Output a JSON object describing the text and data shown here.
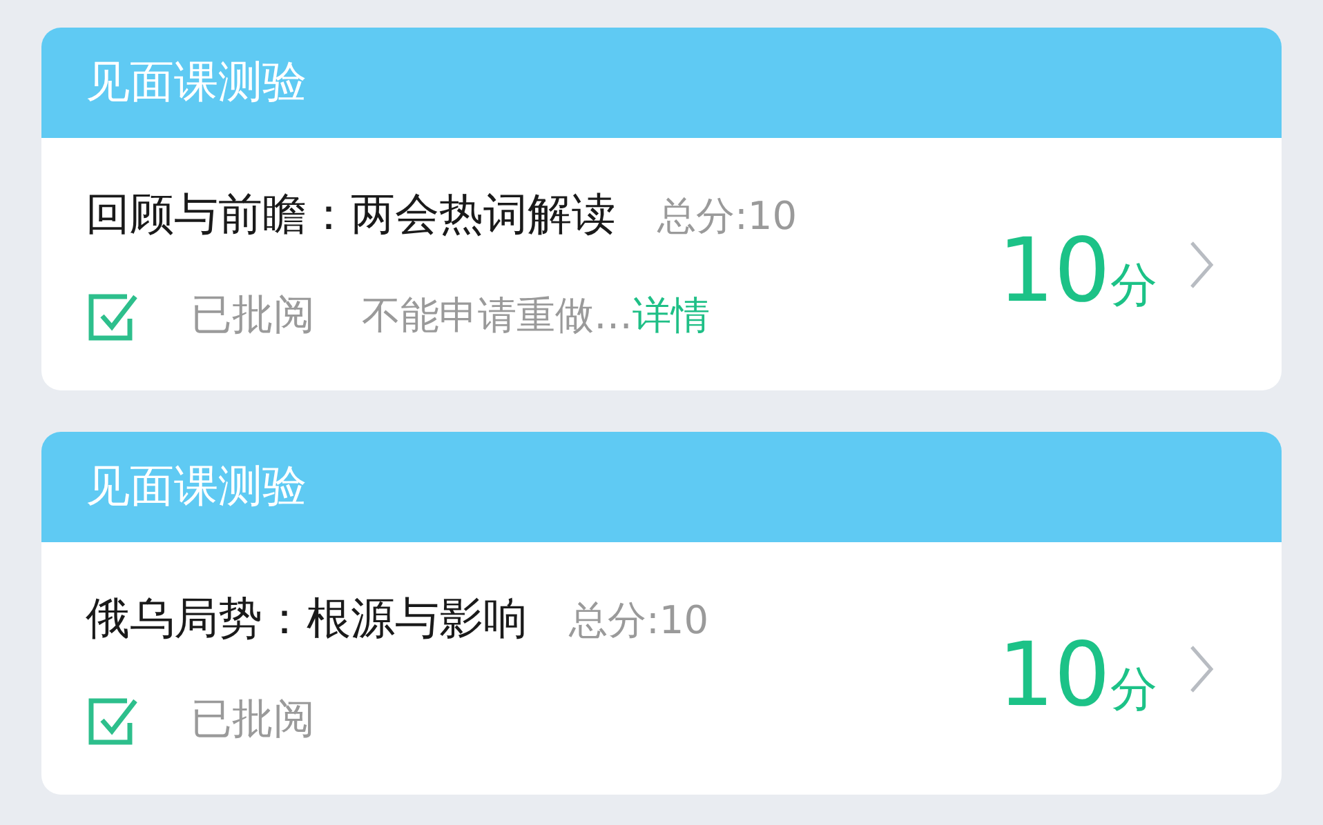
{
  "cards": [
    {
      "header": "见面课测验",
      "title": "回顾与前瞻：两会热词解读",
      "total": "总分:10",
      "status": "已批阅",
      "note": "不能申请重做…",
      "detail_link": "详情",
      "score": "10",
      "score_unit": "分"
    },
    {
      "header": "见面课测验",
      "title": "俄乌局势：根源与影响",
      "total": "总分:10",
      "status": "已批阅",
      "score": "10",
      "score_unit": "分"
    }
  ]
}
